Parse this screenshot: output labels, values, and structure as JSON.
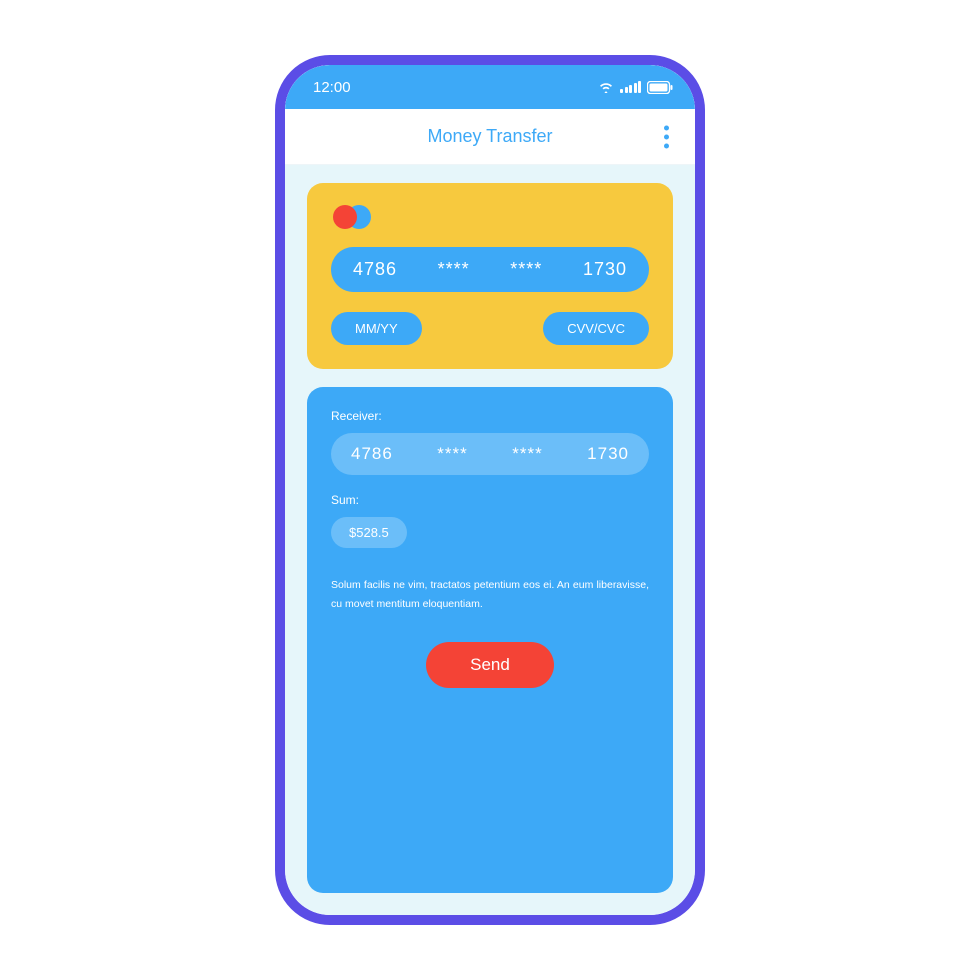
{
  "statusBar": {
    "time": "12:00"
  },
  "header": {
    "title": "Money Transfer"
  },
  "card": {
    "number_p1": "4786",
    "number_p2": "****",
    "number_p3": "****",
    "number_p4": "1730",
    "expiry_placeholder": "MM/YY",
    "cvv_placeholder": "CVV/CVC"
  },
  "receiver": {
    "label": "Receiver:",
    "number_p1": "4786",
    "number_p2": "****",
    "number_p3": "****",
    "number_p4": "1730"
  },
  "sum": {
    "label": "Sum:",
    "value": "$528.5"
  },
  "info": "Solum facilis ne vim, tractatos petentium eos ei. An eum liberavisse, cu movet mentitum eloquentiam.",
  "actions": {
    "send": "Send"
  }
}
